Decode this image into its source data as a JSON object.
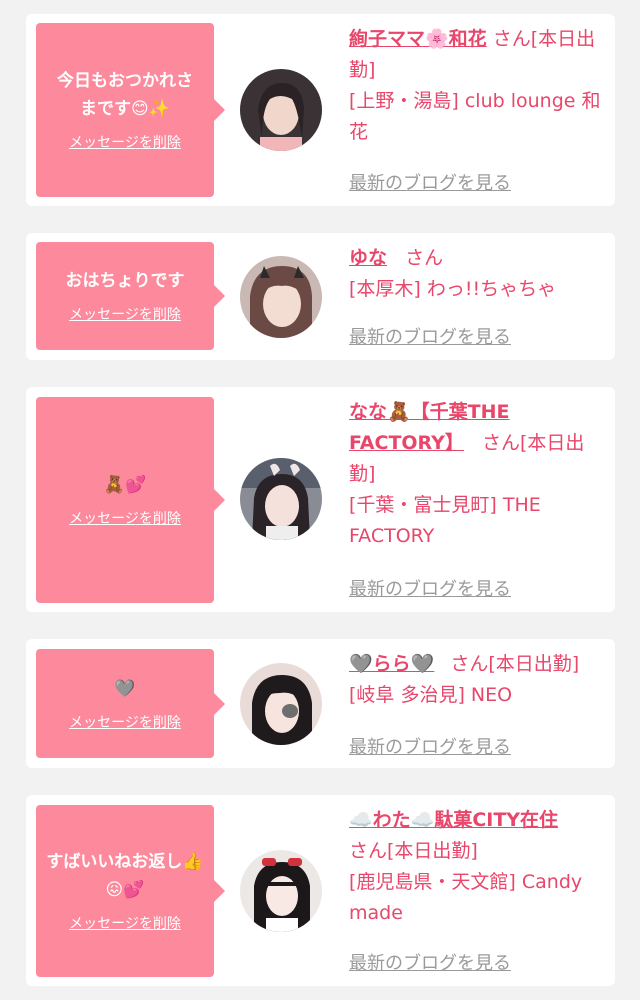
{
  "entries": [
    {
      "message": "今日もおつかれさまです😊✨",
      "delete_label": "メッセージを削除",
      "name": "絢子ママ🌸和花",
      "san": "さん[本日出勤]",
      "shop": "[上野・湯島] club lounge 和花",
      "blog": "最新のブログを見る"
    },
    {
      "message": "おはちょりです",
      "delete_label": "メッセージを削除",
      "name": "ゆな",
      "san": "さん",
      "shop": "[本厚木] わっ!!ちゃちゃ",
      "blog": "最新のブログを見る"
    },
    {
      "message": "🧸💕",
      "delete_label": "メッセージを削除",
      "name": "なな🧸【千葉THE FACTORY】",
      "san": "さん[本日出勤]",
      "shop": "[千葉・富士見町] THE FACTORY",
      "blog": "最新のブログを見る"
    },
    {
      "message": "🩶",
      "delete_label": "メッセージを削除",
      "name": "🩶らら🩶",
      "san": "さん[本日出勤]",
      "shop": "[岐阜 多治見] NEO",
      "blog": "最新のブログを見る"
    },
    {
      "message": "すばいいねお返し👍😖💕",
      "delete_label": "メッセージを削除",
      "name": "☁️わた☁️駄菓CITY在住",
      "san": "さん[本日出勤]",
      "shop": "[鹿児島県・天文館] Candy made",
      "blog": "最新のブログを見る"
    }
  ],
  "colors": {
    "accent": "#e8466a",
    "bubble": "#fd8a9c",
    "muted": "#9a9a9a",
    "background": "#f2f2f2"
  }
}
